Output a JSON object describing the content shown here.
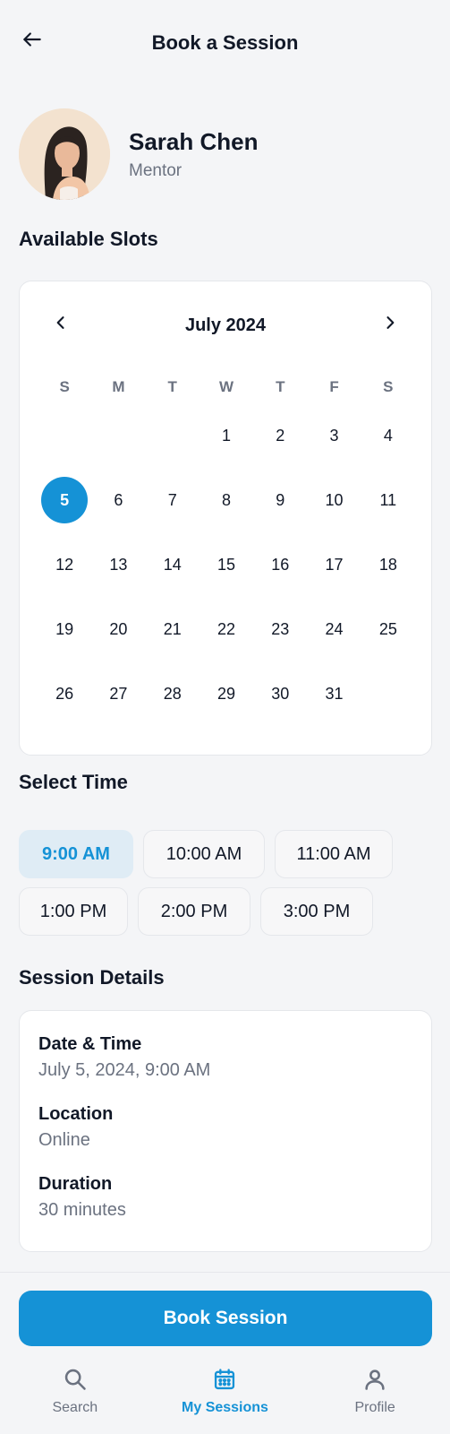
{
  "header": {
    "title": "Book a Session"
  },
  "mentor": {
    "name": "Sarah Chen",
    "role": "Mentor"
  },
  "sections": {
    "available_slots": "Available Slots",
    "select_time": "Select Time",
    "session_details": "Session Details"
  },
  "calendar": {
    "month_label": "July 2024",
    "days_of_week": [
      "S",
      "M",
      "T",
      "W",
      "T",
      "F",
      "S"
    ],
    "weeks": [
      [
        "",
        "",
        "",
        "1",
        "2",
        "3",
        "4"
      ],
      [
        "5",
        "6",
        "7",
        "8",
        "9",
        "10",
        "11"
      ],
      [
        "12",
        "13",
        "14",
        "15",
        "16",
        "17",
        "18"
      ],
      [
        "19",
        "20",
        "21",
        "22",
        "23",
        "24",
        "25"
      ],
      [
        "26",
        "27",
        "28",
        "29",
        "30",
        "31",
        ""
      ]
    ],
    "selected_day": "5",
    "accent_color": "#1592d6"
  },
  "times": {
    "row1": [
      "9:00 AM",
      "10:00 AM",
      "11:00 AM"
    ],
    "row2": [
      "1:00 PM",
      "2:00 PM",
      "3:00 PM"
    ],
    "selected": "9:00 AM"
  },
  "details": {
    "date_time_label": "Date & Time",
    "date_time_value": "July 5, 2024, 9:00 AM",
    "location_label": "Location",
    "location_value": "Online",
    "duration_label": "Duration",
    "duration_value": "30 minutes"
  },
  "book_button": {
    "label": "Book Session"
  },
  "bottom_nav": {
    "items": [
      {
        "label": "Search",
        "icon": "search-icon"
      },
      {
        "label": "My Sessions",
        "icon": "calendar-icon",
        "active": true
      },
      {
        "label": "Profile",
        "icon": "person-icon"
      }
    ]
  }
}
